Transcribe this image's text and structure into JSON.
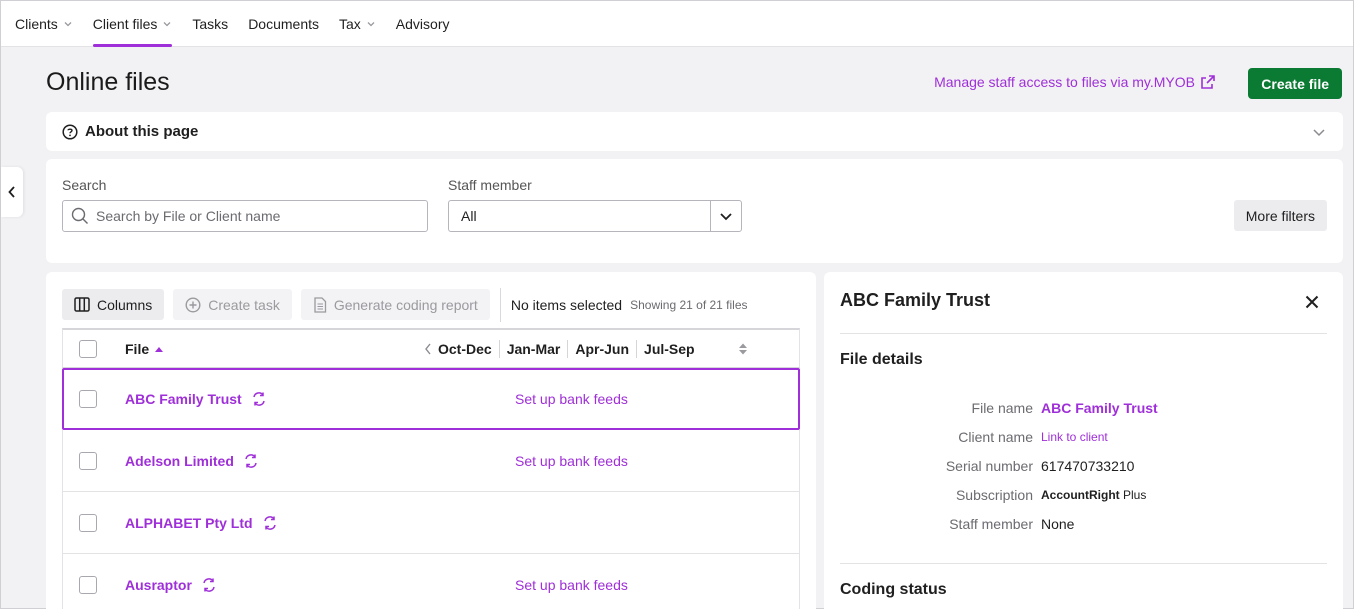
{
  "nav": {
    "items": [
      {
        "label": "Clients",
        "has_chevron": true,
        "active": false
      },
      {
        "label": "Client files",
        "has_chevron": true,
        "active": true
      },
      {
        "label": "Tasks",
        "has_chevron": false,
        "active": false
      },
      {
        "label": "Documents",
        "has_chevron": false,
        "active": false
      },
      {
        "label": "Tax",
        "has_chevron": true,
        "active": false
      },
      {
        "label": "Advisory",
        "has_chevron": false,
        "active": false
      }
    ]
  },
  "page": {
    "title": "Online files",
    "manage_link": "Manage staff access to files via my.MYOB",
    "create_button": "Create file"
  },
  "about": {
    "title": "About this page"
  },
  "filters": {
    "search_label": "Search",
    "search_placeholder": "Search by File or Client name",
    "search_value": "",
    "staff_label": "Staff member",
    "staff_value": "All",
    "more_filters": "More filters"
  },
  "toolbar": {
    "columns": "Columns",
    "create_task": "Create task",
    "coding_report": "Generate coding report",
    "selection": "No items selected",
    "showing": "Showing 21 of 21 files"
  },
  "table": {
    "file_header": "File",
    "months": [
      "Oct-Dec",
      "Jan-Mar",
      "Apr-Jun",
      "Jul-Sep"
    ],
    "rows": [
      {
        "name": "ABC Family Trust",
        "bank_link": "Set up bank feeds",
        "selected": true
      },
      {
        "name": "Adelson Limited",
        "bank_link": "Set up bank feeds",
        "selected": false
      },
      {
        "name": "ALPHABET Pty Ltd",
        "bank_link": "",
        "selected": false
      },
      {
        "name": "Ausraptor",
        "bank_link": "Set up bank feeds",
        "selected": false
      }
    ]
  },
  "details": {
    "title": "ABC Family Trust",
    "file_details_heading": "File details",
    "fields": {
      "file_name_label": "File name",
      "file_name_value": "ABC Family Trust",
      "client_name_label": "Client name",
      "client_name_value": "Link to client",
      "serial_label": "Serial number",
      "serial_value": "617470733210",
      "subscription_label": "Subscription",
      "subscription_product": "AccountRight",
      "subscription_tier": "Plus",
      "staff_label": "Staff member",
      "staff_value": "None"
    },
    "coding_status_heading": "Coding status"
  },
  "colors": {
    "accent": "#9f2fd8",
    "primary_button": "#0b7a32",
    "background": "#f2f2f4"
  }
}
